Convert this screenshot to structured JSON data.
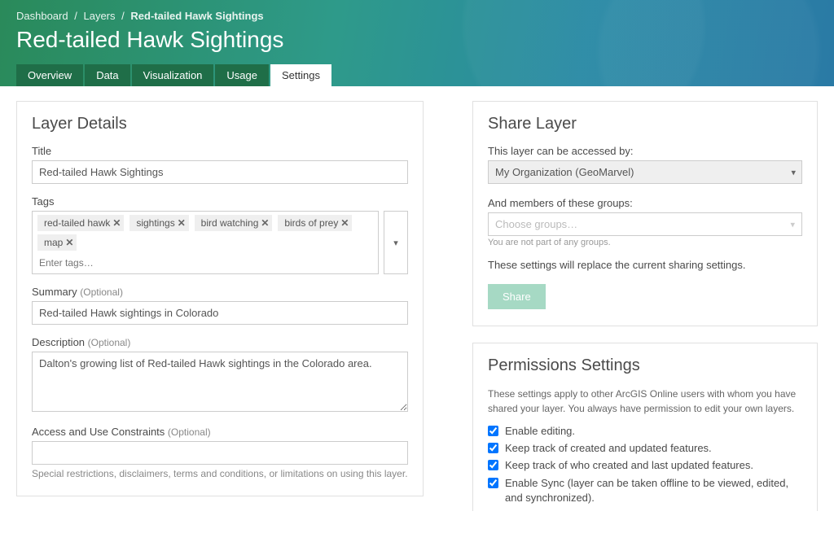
{
  "breadcrumb": {
    "items": [
      "Dashboard",
      "Layers"
    ],
    "current": "Red-tailed Hawk Sightings"
  },
  "page_title": "Red-tailed Hawk Sightings",
  "tabs": {
    "items": [
      {
        "label": "Overview"
      },
      {
        "label": "Data"
      },
      {
        "label": "Visualization"
      },
      {
        "label": "Usage"
      },
      {
        "label": "Settings",
        "active": true
      }
    ]
  },
  "details": {
    "panel_title": "Layer Details",
    "title_label": "Title",
    "title_value": "Red-tailed Hawk Sightings",
    "tags_label": "Tags",
    "tags": [
      "red-tailed hawk",
      "sightings",
      "bird watching",
      "birds of prey",
      "map"
    ],
    "tags_placeholder": "Enter tags…",
    "summary_label": "Summary",
    "summary_value": "Red-tailed Hawk sightings in Colorado",
    "description_label": "Description",
    "description_value": "Dalton's growing list of Red-tailed Hawk sightings in the Colorado area.",
    "constraints_label": "Access and Use Constraints",
    "constraints_hint": "Special restrictions, disclaimers, terms and conditions, or limitations on using this layer.",
    "optional": "(Optional)"
  },
  "share": {
    "panel_title": "Share Layer",
    "access_label": "This layer can be accessed by:",
    "access_value": "My Organization (GeoMarvel)",
    "groups_label": "And members of these groups:",
    "groups_placeholder": "Choose groups…",
    "groups_hint": "You are not part of any groups.",
    "note": "These settings will replace the current sharing settings.",
    "share_button": "Share"
  },
  "permissions": {
    "panel_title": "Permissions Settings",
    "intro": "These settings apply to other ArcGIS Online users with whom you have shared your layer. You always have permission to edit your own layers.",
    "options": [
      {
        "label": "Enable editing.",
        "checked": true
      },
      {
        "label": "Keep track of created and updated features.",
        "checked": true
      },
      {
        "label": "Keep track of who created and last updated features.",
        "checked": true
      },
      {
        "label": "Enable Sync (layer can be taken offline to be viewed, edited, and synchronized).",
        "checked": true
      }
    ]
  }
}
